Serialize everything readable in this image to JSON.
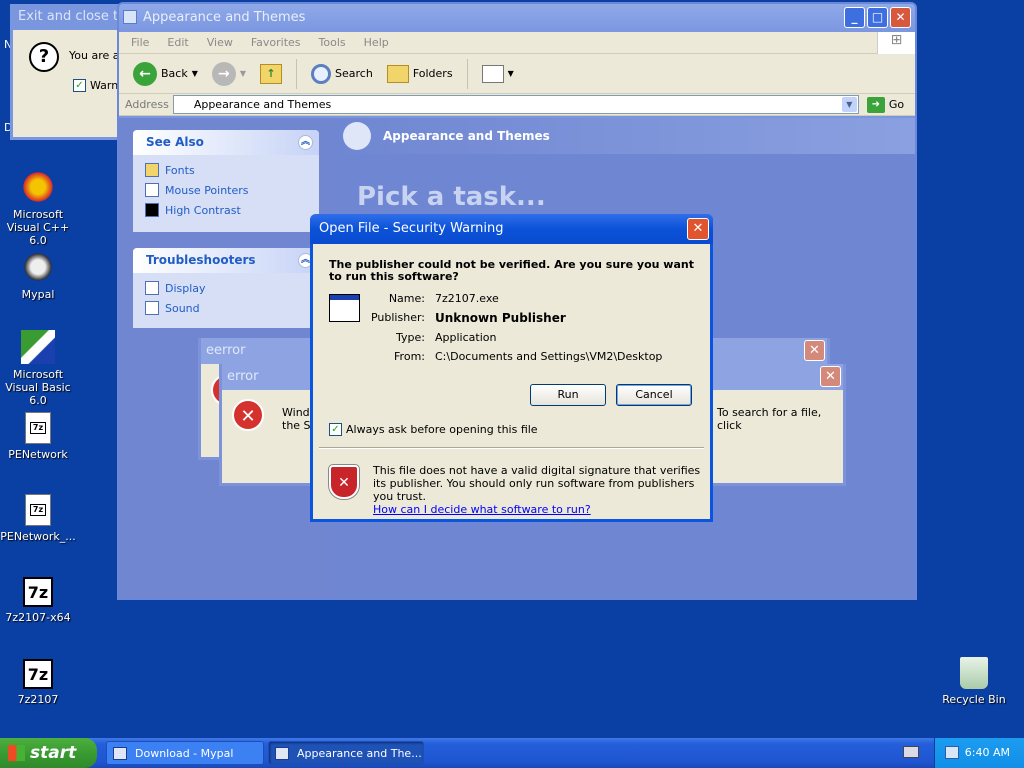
{
  "desktop": {
    "icons": [
      {
        "label": "Microsoft Visual C++ 6.0"
      },
      {
        "label": "Mypal"
      },
      {
        "label": "Microsoft Visual Basic 6.0"
      },
      {
        "label": "PENetwork"
      },
      {
        "label": "PENetwork_..."
      },
      {
        "label": "7z2107-x64"
      },
      {
        "label": "7z2107"
      },
      {
        "label": "Recycle Bin"
      }
    ],
    "partial_letters": [
      "N",
      "D"
    ]
  },
  "exit_window": {
    "title": "Exit and close ta",
    "text": "You are ab",
    "checkbox_label": "Warn"
  },
  "explorer": {
    "title": "Appearance and Themes",
    "menu": [
      "File",
      "Edit",
      "View",
      "Favorites",
      "Tools",
      "Help"
    ],
    "toolbar": {
      "back": "Back",
      "search": "Search",
      "folders": "Folders"
    },
    "address_label": "Address",
    "address_value": "Appearance and Themes",
    "go_label": "Go",
    "see_also": {
      "title": "See Also",
      "items": [
        "Fonts",
        "Mouse Pointers",
        "High Contrast"
      ]
    },
    "troubleshooters": {
      "title": "Troubleshooters",
      "items": [
        "Display",
        "Sound"
      ]
    },
    "header": "Appearance and Themes",
    "pick_task": "Pick a task..."
  },
  "error_back": {
    "title": "eerror"
  },
  "error_front": {
    "title": "error",
    "text_left": "Windo",
    "text_left2": "the St",
    "text_right": "To search for a file, click"
  },
  "security_dialog": {
    "title": "Open File - Security Warning",
    "question": "The publisher could not be verified.  Are you sure you want to run this software?",
    "fields": [
      {
        "label": "Name:",
        "value": "7z2107.exe"
      },
      {
        "label": "Publisher:",
        "value": "Unknown Publisher"
      },
      {
        "label": "Type:",
        "value": "Application"
      },
      {
        "label": "From:",
        "value": "C:\\Documents and Settings\\VM2\\Desktop"
      }
    ],
    "run_label": "Run",
    "cancel_label": "Cancel",
    "always_ask_label": "Always ask before opening this file",
    "always_ask_checked": true,
    "info_text": "This file does not have a valid digital signature that verifies its publisher.  You should only run software from publishers you trust.",
    "info_link": "How can I decide what software to run?"
  },
  "taskbar": {
    "start_label": "start",
    "tasks": [
      {
        "label": "Download - Mypal"
      },
      {
        "label": "Appearance and The..."
      }
    ],
    "clock": "6:40 AM"
  }
}
